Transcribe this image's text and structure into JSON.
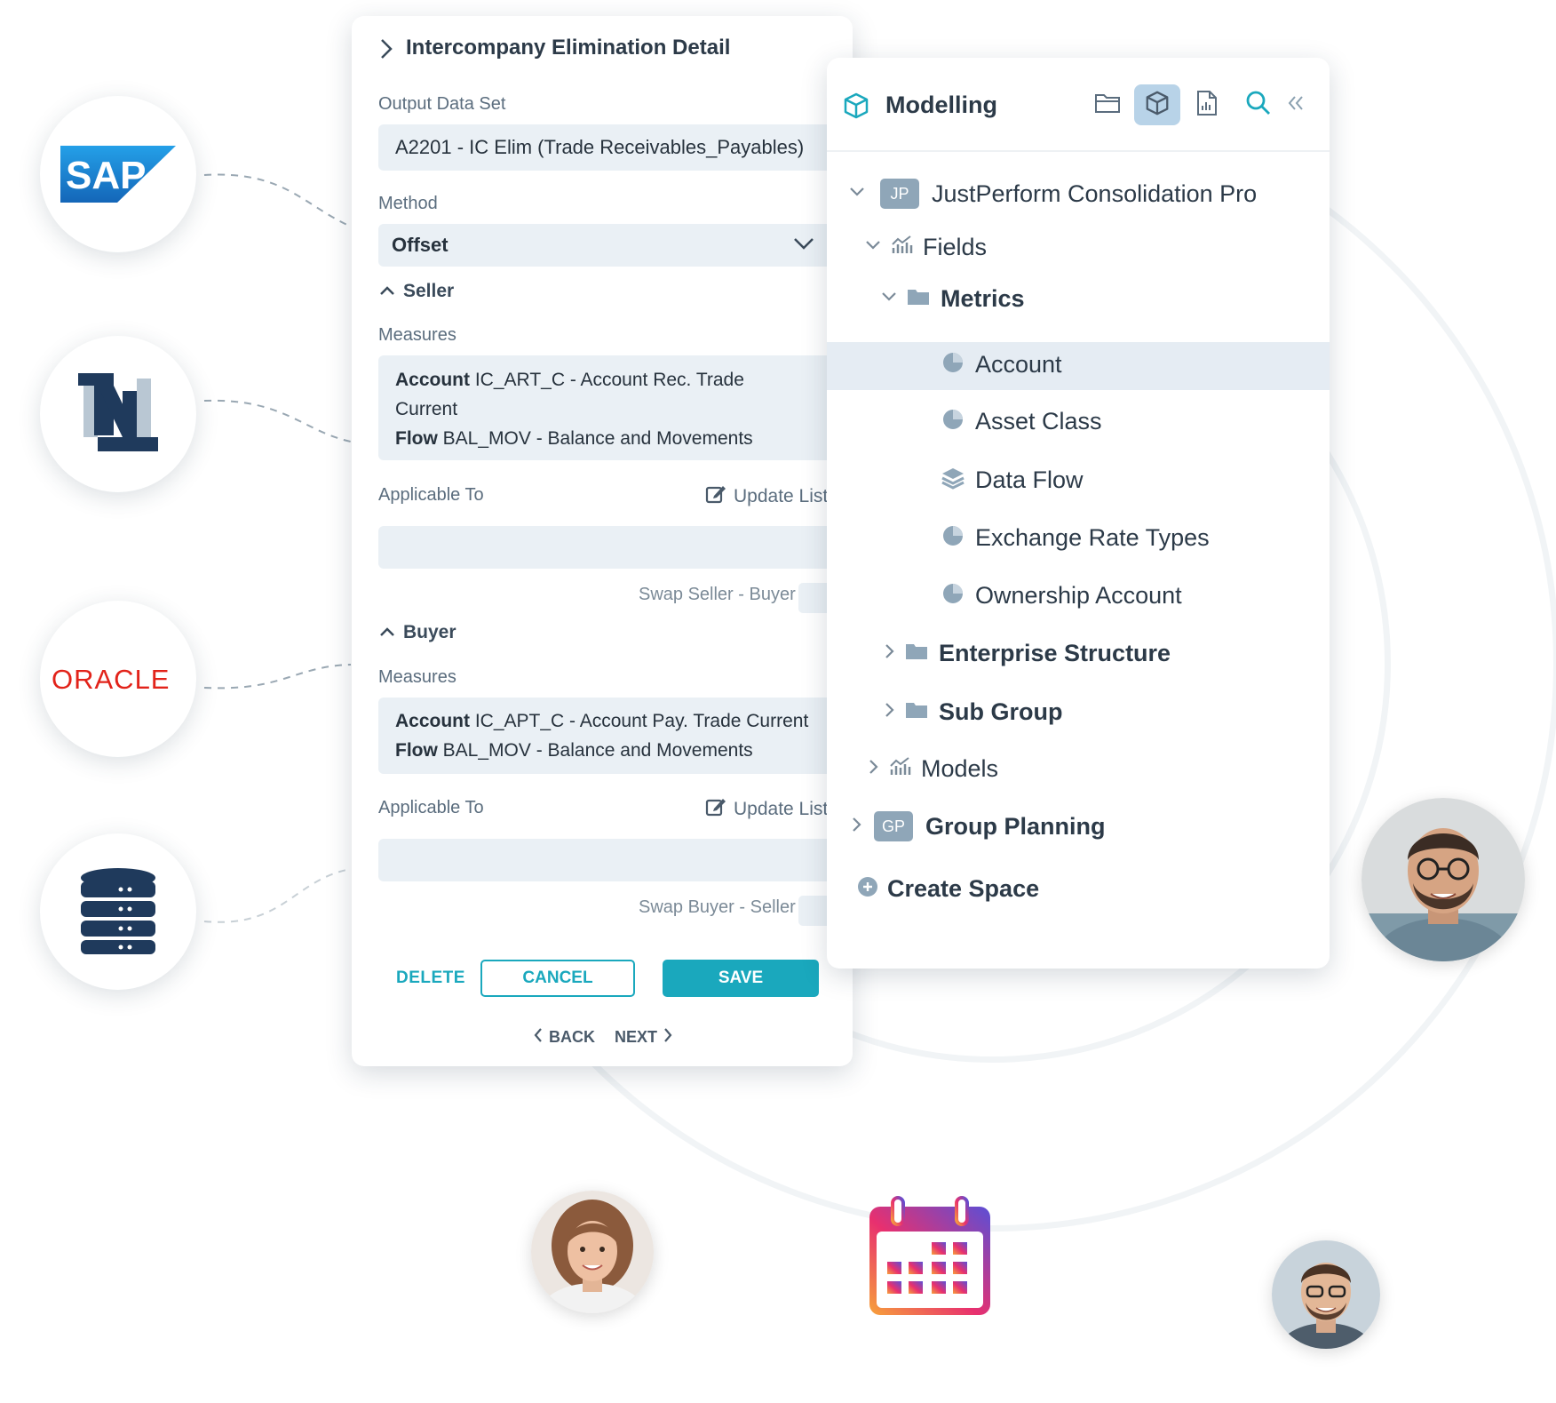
{
  "left_panel": {
    "title": "Intercompany Elimination Detail",
    "output_data_set_label": "Output Data Set",
    "output_data_set_value": "A2201 - IC Elim (Trade Receivables_Payables)",
    "method_label": "Method",
    "method_value": "Offset",
    "seller": {
      "header": "Seller",
      "measures_label": "Measures",
      "account_label": "Account",
      "account_value_line1": "IC_ART_C - Account Rec. Trade",
      "account_value_line2": "Current",
      "flow_label": "Flow",
      "flow_value": "BAL_MOV - Balance and Movements",
      "applicable_to_label": "Applicable To",
      "update_list": "Update List",
      "swap_label": "Swap Seller - Buyer"
    },
    "buyer": {
      "header": "Buyer",
      "measures_label": "Measures",
      "account_label": "Account",
      "account_value": "IC_APT_C - Account Pay. Trade Current",
      "flow_label": "Flow",
      "flow_value": "BAL_MOV - Balance and Movements",
      "applicable_to_label": "Applicable To",
      "update_list": "Update List",
      "swap_label": "Swap Buyer - Seller"
    },
    "buttons": {
      "delete": "DELETE",
      "cancel": "CANCEL",
      "save": "SAVE",
      "back": "BACK",
      "next": "NEXT"
    }
  },
  "right_panel": {
    "title": "Modelling",
    "toolbar": [
      "folder-icon",
      "cube-icon",
      "report-icon",
      "search-icon",
      "collapse-icon"
    ],
    "space": {
      "badge": "JP",
      "name": "JustPerform Consolidation Pro"
    },
    "fields_label": "Fields",
    "metrics_label": "Metrics",
    "metric_items": [
      "Account",
      "Asset Class",
      "Data Flow",
      "Exchange Rate Types",
      "Ownership Account"
    ],
    "enterprise_structure": "Enterprise Structure",
    "sub_group": "Sub Group",
    "models": "Models",
    "group_planning": {
      "badge": "GP",
      "name": "Group Planning"
    },
    "create_space": "Create Space"
  },
  "logos": [
    "SAP",
    "ORACLE"
  ],
  "colors": {
    "accent": "#1aa8bd",
    "field_bg": "#eaf0f5",
    "selected_row": "#e5ecf3",
    "oracle_red": "#e2231a",
    "sap_blue": "#1b75c9"
  }
}
